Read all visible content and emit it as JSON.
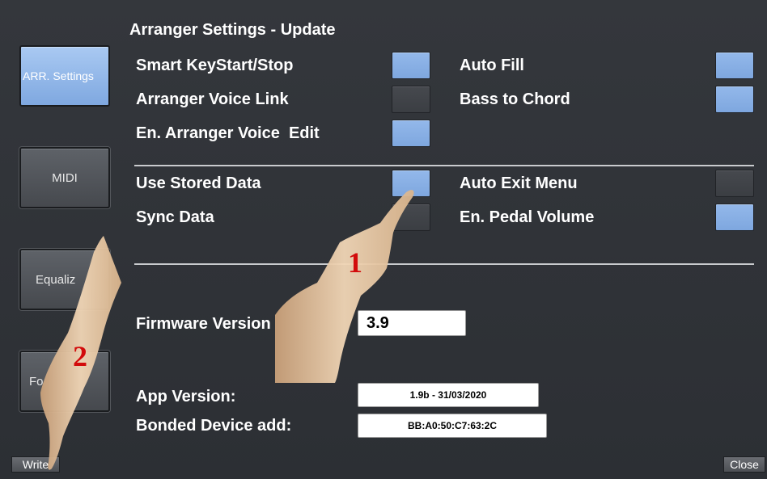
{
  "title": "Arranger Settings - Update",
  "sidebar": {
    "items": [
      {
        "label": "ARR. Settings",
        "active": true
      },
      {
        "label": "MIDI",
        "active": false
      },
      {
        "label": "Equaliz",
        "active": false
      },
      {
        "label": "Fo",
        "active": false
      }
    ]
  },
  "settings_group_1": {
    "smart_keystart": {
      "label": "Smart KeyStart/Stop",
      "on": true
    },
    "auto_fill": {
      "label": "Auto Fill",
      "on": true
    },
    "arranger_voice_link": {
      "label": "Arranger Voice Link",
      "on": false
    },
    "bass_to_chord": {
      "label": "Bass to Chord",
      "on": true
    },
    "en_arranger_voice_edit": {
      "label": "En. Arranger Voice  Edit",
      "on": true
    }
  },
  "settings_group_2": {
    "use_stored_data": {
      "label": "Use Stored Data",
      "on": true
    },
    "auto_exit_menu": {
      "label": "Auto Exit Menu",
      "on": false
    },
    "sync_data": {
      "label": "Sync Data",
      "on": false
    },
    "en_pedal_volume": {
      "label": "En. Pedal Volume",
      "on": true
    }
  },
  "info": {
    "firmware_label": "Firmware Version",
    "firmware_value": "3.9",
    "app_label": "App Version:",
    "app_value": "1.9b - 31/03/2020",
    "bonded_label": "Bonded Device add:",
    "bonded_value": "BB:A0:50:C7:63:2C"
  },
  "footer": {
    "write_label": "Write",
    "close_label": "Close"
  },
  "annotations": {
    "marker_1": "1",
    "marker_2": "2"
  },
  "colors": {
    "toggle_on": "#8fb4e8",
    "toggle_off": "#43464b",
    "background": "#2f3237",
    "marker": "#d20b0b"
  }
}
